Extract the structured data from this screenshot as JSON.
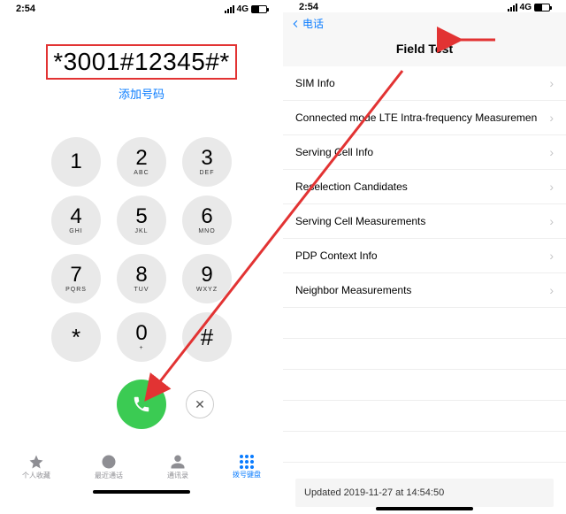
{
  "left": {
    "status": {
      "time": "2:54",
      "network": "4G"
    },
    "dialed": "*3001#12345#*",
    "add_number_label": "添加号码",
    "keypad": {
      "1": {
        "num": "1",
        "sub": ""
      },
      "2": {
        "num": "2",
        "sub": "ABC"
      },
      "3": {
        "num": "3",
        "sub": "DEF"
      },
      "4": {
        "num": "4",
        "sub": "GHI"
      },
      "5": {
        "num": "5",
        "sub": "JKL"
      },
      "6": {
        "num": "6",
        "sub": "MNO"
      },
      "7": {
        "num": "7",
        "sub": "PQRS"
      },
      "8": {
        "num": "8",
        "sub": "TUV"
      },
      "9": {
        "num": "9",
        "sub": "WXYZ"
      },
      "star": {
        "num": "*",
        "sub": ""
      },
      "0": {
        "num": "0",
        "sub": "+"
      },
      "hash": {
        "num": "#",
        "sub": ""
      }
    },
    "tabs": {
      "favorites": "个人收藏",
      "recents": "最近通话",
      "contacts": "通讯录",
      "keypad": "拨号键盘"
    }
  },
  "right": {
    "status": {
      "time": "2:54",
      "network": "4G"
    },
    "back_label": "电话",
    "title": "Field Test",
    "items": [
      "SIM Info",
      "Connected mode LTE Intra-frequency Measuremen",
      "Serving Cell Info",
      "Reselection Candidates",
      "Serving Cell Measurements",
      "PDP Context Info",
      "Neighbor Measurements"
    ],
    "updated": "Updated 2019-11-27 at 14:54:50"
  }
}
